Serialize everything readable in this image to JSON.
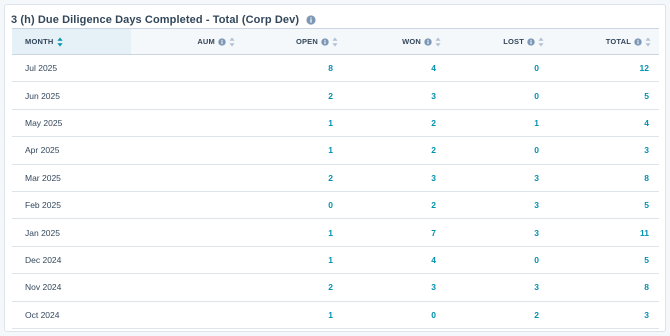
{
  "title": "3 (h) Due Diligence Days Completed - Total (Corp Dev)",
  "colors": {
    "link": "#0091ae",
    "text": "#33475b",
    "header_bg": "#f5f8fa",
    "sorted_bg": "#e5f0f7",
    "border": "#cbd6e2"
  },
  "icons": {
    "info": "info-icon",
    "sort": "sort-icon",
    "sort_active": "sort-ascending-icon"
  },
  "columns": [
    {
      "label": "MONTH",
      "key": "month"
    },
    {
      "label": "AUM",
      "key": "aum"
    },
    {
      "label": "OPEN",
      "key": "open"
    },
    {
      "label": "WON",
      "key": "won"
    },
    {
      "label": "LOST",
      "key": "lost"
    },
    {
      "label": "TOTAL",
      "key": "total"
    }
  ],
  "rows": [
    {
      "month": "Jul 2025",
      "open": "8",
      "won": "4",
      "lost": "0",
      "total": "12"
    },
    {
      "month": "Jun 2025",
      "open": "2",
      "won": "3",
      "lost": "0",
      "total": "5"
    },
    {
      "month": "May 2025",
      "open": "1",
      "won": "2",
      "lost": "1",
      "total": "4"
    },
    {
      "month": "Apr 2025",
      "open": "1",
      "won": "2",
      "lost": "0",
      "total": "3"
    },
    {
      "month": "Mar 2025",
      "open": "2",
      "won": "3",
      "lost": "3",
      "total": "8"
    },
    {
      "month": "Feb 2025",
      "open": "0",
      "won": "2",
      "lost": "3",
      "total": "5"
    },
    {
      "month": "Jan 2025",
      "open": "1",
      "won": "7",
      "lost": "3",
      "total": "11"
    },
    {
      "month": "Dec 2024",
      "open": "1",
      "won": "4",
      "lost": "0",
      "total": "5"
    },
    {
      "month": "Nov 2024",
      "open": "2",
      "won": "3",
      "lost": "3",
      "total": "8"
    },
    {
      "month": "Oct 2024",
      "open": "1",
      "won": "0",
      "lost": "2",
      "total": "3"
    }
  ]
}
